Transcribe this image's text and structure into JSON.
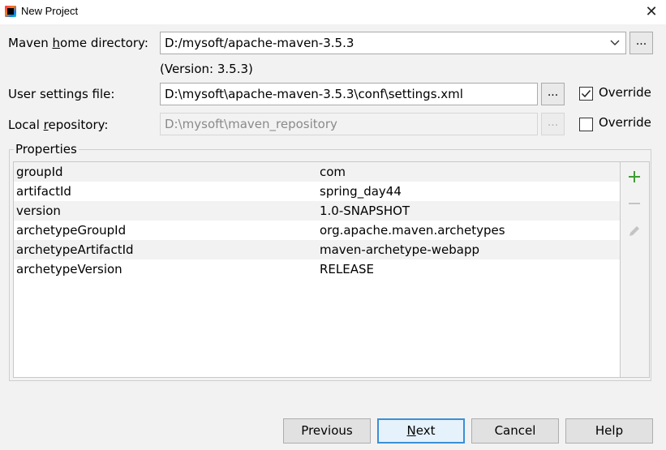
{
  "window": {
    "title": "New Project",
    "close_glyph": "✕"
  },
  "maven_home": {
    "label_pre": "Maven ",
    "label_mnemonic": "h",
    "label_post": "ome directory:",
    "value": "D:/mysoft/apache-maven-3.5.3",
    "version": "(Version: 3.5.3)",
    "browse_label": "..."
  },
  "user_settings": {
    "label": "User settings file:",
    "value": "D:\\mysoft\\apache-maven-3.5.3\\conf\\settings.xml",
    "browse_label": "...",
    "override_label": "Override",
    "override_checked": true
  },
  "local_repo": {
    "label_pre": "Local ",
    "label_mnemonic": "r",
    "label_post": "epository:",
    "value": "D:\\mysoft\\maven_repository",
    "browse_label": "...",
    "override_label": "Override",
    "override_checked": false
  },
  "properties": {
    "title": "Properties",
    "rows": [
      {
        "key": "groupId",
        "value": "com"
      },
      {
        "key": "artifactId",
        "value": "spring_day44"
      },
      {
        "key": "version",
        "value": "1.0-SNAPSHOT"
      },
      {
        "key": "archetypeGroupId",
        "value": "org.apache.maven.archetypes"
      },
      {
        "key": "archetypeArtifactId",
        "value": "maven-archetype-webapp"
      },
      {
        "key": "archetypeVersion",
        "value": "RELEASE"
      }
    ],
    "tools": {
      "add_icon": "plus-icon",
      "remove_icon": "minus-icon",
      "edit_icon": "pencil-icon",
      "add_color": "#3f9c35",
      "disabled_color": "#b8b8b8"
    }
  },
  "buttons": {
    "previous": "Previous",
    "next_mnemonic": "N",
    "next_rest": "ext",
    "cancel": "Cancel",
    "help": "Help"
  }
}
